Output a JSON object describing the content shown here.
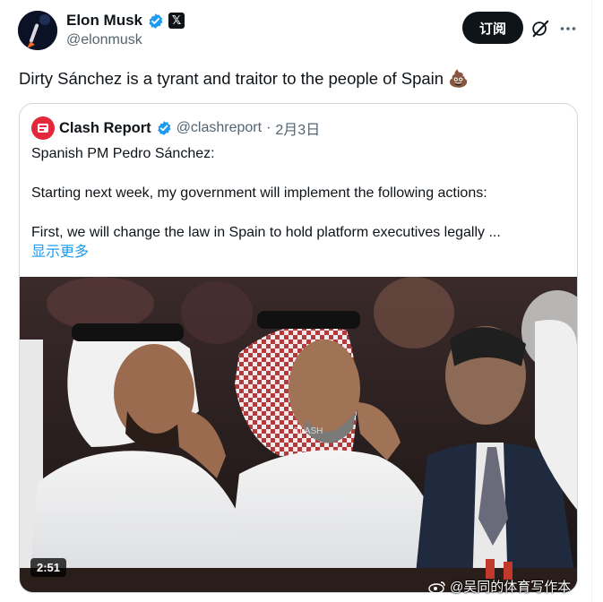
{
  "author": {
    "name": "Elon Musk",
    "handle": "@elonmusk"
  },
  "actions": {
    "subscribe_label": "订阅"
  },
  "post": {
    "text": "Dirty Sánchez is a tyrant and traitor to the people of Spain 💩"
  },
  "quote": {
    "name": "Clash Report",
    "handle": "@clashreport",
    "separator": "·",
    "date": "2月3日",
    "lines": [
      "Spanish PM Pedro Sánchez:",
      "Starting next week, my government will implement the following actions:",
      "First, we will change the law in Spain to hold platform executives legally ..."
    ],
    "show_more": "显示更多",
    "video": {
      "duration": "2:51",
      "overlay_text": "CLASH"
    }
  },
  "watermark": {
    "text": "@吴同的体育写作本"
  },
  "colors": {
    "verified_blue": "#1d9bf0",
    "link_blue": "#1d9bf0",
    "secondary_text": "#536471",
    "border": "#cfd9de",
    "clash_red": "#e2283a"
  },
  "icons": [
    "verified-badge-icon",
    "x-logo-icon",
    "grok-icon",
    "more-icon",
    "play-duration-badge"
  ]
}
